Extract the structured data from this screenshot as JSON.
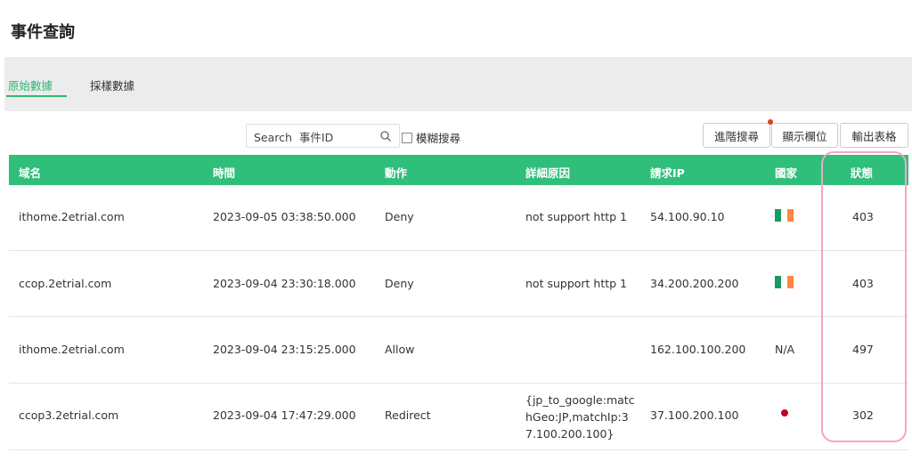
{
  "page": {
    "title": "事件查詢"
  },
  "tabs": [
    {
      "label": "原始數據",
      "active": true
    },
    {
      "label": "採樣數據",
      "active": false
    }
  ],
  "search": {
    "placeholder": "Search  事件ID",
    "value": ""
  },
  "fuzzy_search": {
    "label": "模糊搜尋",
    "checked": false
  },
  "toolbar": {
    "advanced_search_label": "進階搜尋",
    "show_columns_label": "顯示欄位",
    "export_label": "輸出表格"
  },
  "colors": {
    "accent": "#30be7b",
    "notification_dot": "#e03c1e",
    "highlight": "#f2a7c4"
  },
  "table": {
    "headers": {
      "domain": "域名",
      "time": "時間",
      "action": "動作",
      "reason": "詳細原因",
      "request_ip": "請求IP",
      "country": "國家",
      "status": "狀態"
    },
    "rows": [
      {
        "domain": "ithome.2etrial.com",
        "time": "2023-09-05 03:38:50.000",
        "action": "Deny",
        "reason": "not support http 1",
        "request_ip": "54.100.90.10",
        "country": "ireland-flag-icon",
        "status": "403"
      },
      {
        "domain": "ccop.2etrial.com",
        "time": "2023-09-04 23:30:18.000",
        "action": "Deny",
        "reason": "not support http 1",
        "request_ip": "34.200.200.200",
        "country": "ireland-flag-icon",
        "status": "403"
      },
      {
        "domain": "ithome.2etrial.com",
        "time": "2023-09-04 23:15:25.000",
        "action": "Allow",
        "reason": "",
        "request_ip": "162.100.100.200",
        "country": "N/A",
        "status": "497"
      },
      {
        "domain": "ccop3.2etrial.com",
        "time": "2023-09-04 17:47:29.000",
        "action": "Redirect",
        "reason_lines": [
          "{jp_to_google:matc",
          "hGeo:JP,matchIp:3",
          "7.100.200.100}"
        ],
        "request_ip": "37.100.200.100",
        "country": "japan-flag-icon",
        "status": "302"
      }
    ]
  }
}
